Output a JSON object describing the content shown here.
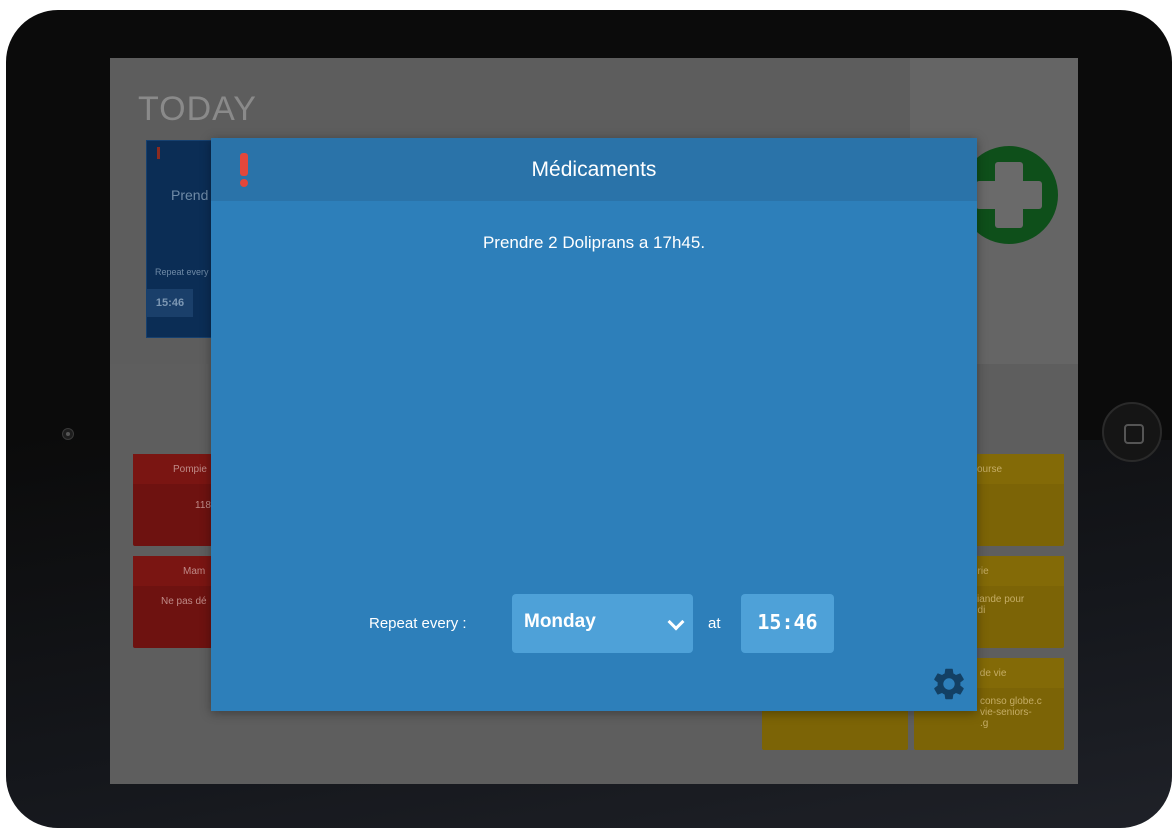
{
  "background": {
    "today_title": "TODAY",
    "card": {
      "text": "Prend",
      "repeat": "Repeat every",
      "time": "15:46"
    },
    "tiles": [
      {
        "title": "Pompie",
        "body": "118",
        "color": "red"
      },
      {
        "title": "Mam",
        "body": "Ne pas dé",
        "color": "red"
      },
      {
        "title": "course",
        "body": "",
        "color": "yellow"
      },
      {
        "title": "erie",
        "body": "viande pour\nedi",
        "color": "yellow"
      },
      {
        "title": "s de vie",
        "body": "conso globe.c\nvie-seniors-\n.g",
        "color": "yellow"
      }
    ]
  },
  "modal": {
    "title": "Médicaments",
    "body": "Prendre 2 Doliprans a 17h45.",
    "repeat_label": "Repeat every :",
    "day_value": "Monday",
    "at_label": "at",
    "time_value": "15:46"
  },
  "icons": {
    "alert": "exclamation-icon",
    "settings": "gear-icon",
    "add": "plus-icon",
    "dropdown": "chevron-down-icon"
  },
  "colors": {
    "modal_bg": "#2d7fba",
    "modal_header": "#2a73a9",
    "field_bg": "#4ea1d8",
    "alert": "#e3473b"
  }
}
